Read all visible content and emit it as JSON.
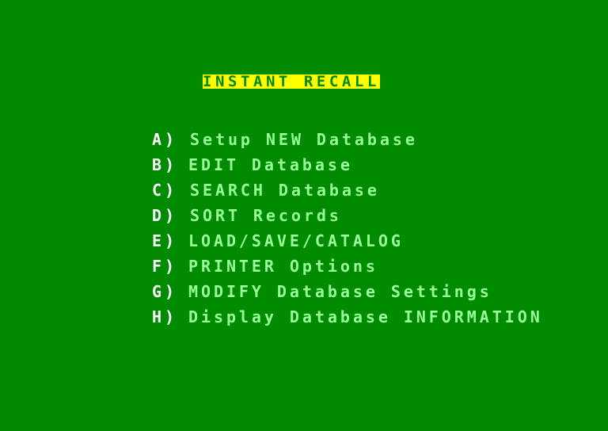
{
  "screen": {
    "title": "INSTANT RECALL",
    "colors": {
      "background": "#008b00",
      "title_background": "#ffff00",
      "title_text": "#008b00",
      "key_text": "#ffffff",
      "item_text": "#99ff99"
    }
  },
  "menu": {
    "items": [
      {
        "key": "A)",
        "label": "Setup NEW Database"
      },
      {
        "key": "B)",
        "label": "EDIT Database"
      },
      {
        "key": "C)",
        "label": "SEARCH Database"
      },
      {
        "key": "D)",
        "label": "SORT Records"
      },
      {
        "key": "E)",
        "label": "LOAD/SAVE/CATALOG"
      },
      {
        "key": "F)",
        "label": "PRINTER Options"
      },
      {
        "key": "G)",
        "label": "MODIFY Database Settings"
      },
      {
        "key": "H)",
        "label": "Display Database INFORMATION"
      }
    ]
  }
}
